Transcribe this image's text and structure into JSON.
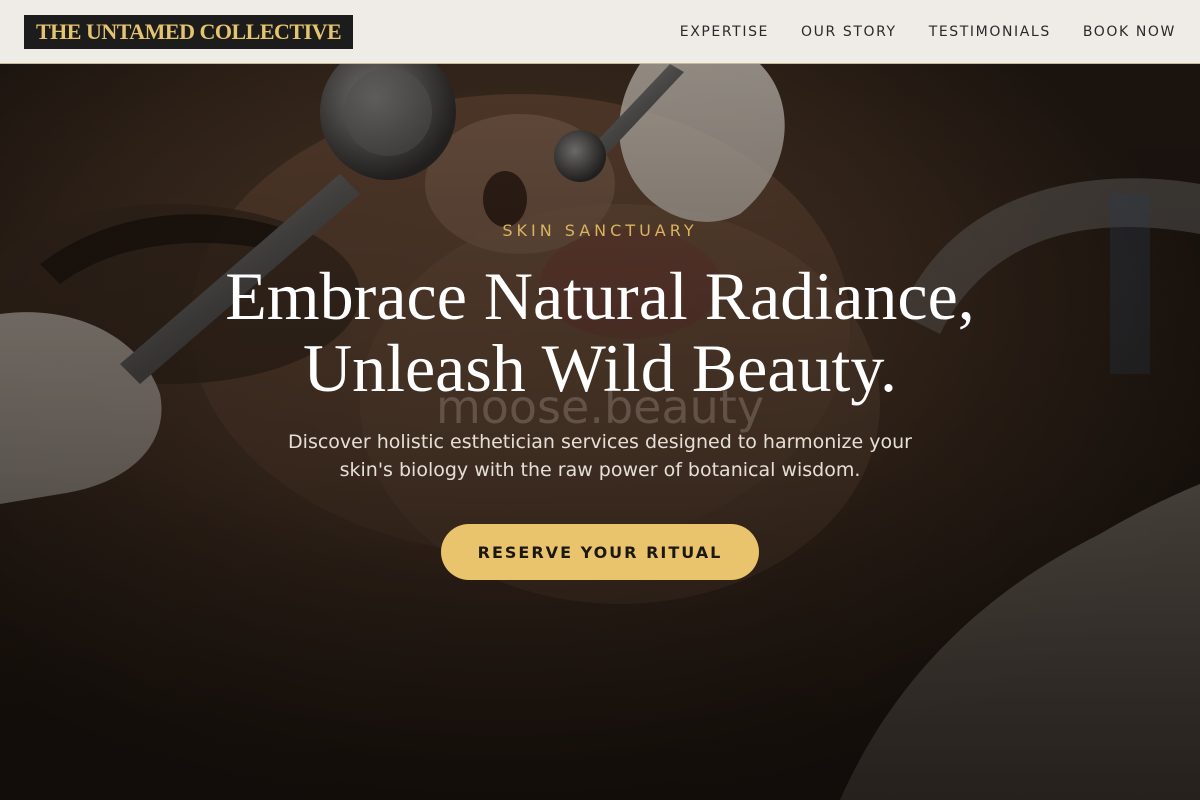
{
  "header": {
    "logo_text": "THE UNTAMED COLLECTIVE",
    "nav": [
      {
        "label": "EXPERTISE"
      },
      {
        "label": "OUR STORY"
      },
      {
        "label": "TESTIMONIALS"
      },
      {
        "label": "BOOK NOW"
      }
    ]
  },
  "hero": {
    "eyebrow": "SKIN SANCTUARY",
    "headline_line1": "Embrace Natural Radiance,",
    "headline_line2": "Unleash Wild Beauty.",
    "subtext_line1": "Discover holistic esthetician services designed to harmonize your",
    "subtext_line2": "skin's biology with the raw power of botanical wisdom.",
    "cta_label": "RESERVE YOUR RITUAL",
    "watermark": "moose.beauty"
  },
  "colors": {
    "accent_gold": "#e9c46c",
    "logo_bg": "#1c1c1c",
    "header_bg": "#efece7",
    "hero_dark": "#1b140f"
  }
}
